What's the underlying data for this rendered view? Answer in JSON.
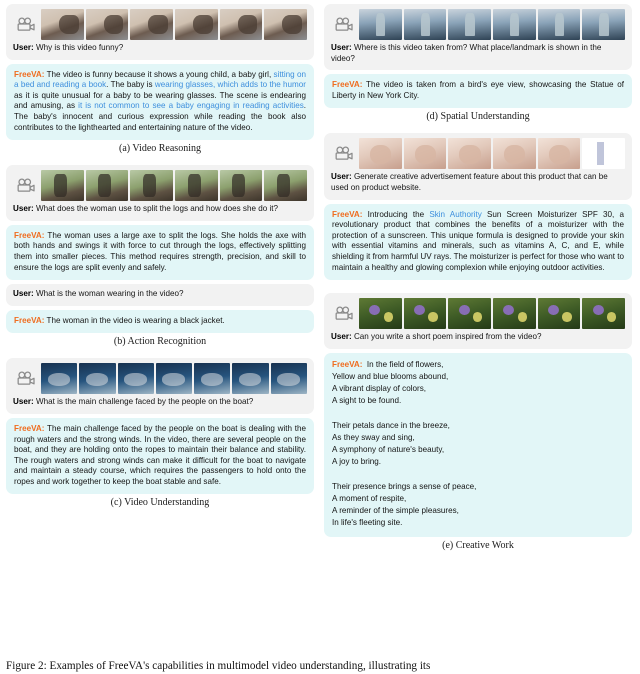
{
  "figure": {
    "caption": "Figure 2: Examples of FreeVA's capabilities in multimodel video understanding, illustrating its"
  },
  "labels": {
    "user": "User:",
    "assistant": "FreeVA:",
    "camera_icon": "movie-camera-icon"
  },
  "colors": {
    "user_bubble": "#f2f2f2",
    "assistant_bubble": "#e2f6f7",
    "assistant_name": "#ef6c1f",
    "highlight_text": "#3d8fdd",
    "body_text": "#151515"
  },
  "panels": [
    {
      "id": "a",
      "subcaption": "(a) Video Reasoning",
      "thumbnail_count": 6,
      "thumbnail_style": "t-baby",
      "turns": [
        {
          "role": "user",
          "segments": [
            {
              "text": "Why is this video funny?",
              "highlight": false
            }
          ]
        },
        {
          "role": "assistant",
          "segments": [
            {
              "text": " The video is funny because it shows a young child, a baby girl, ",
              "highlight": false
            },
            {
              "text": "sitting on a bed and reading a book",
              "highlight": true
            },
            {
              "text": ". The baby is ",
              "highlight": false
            },
            {
              "text": "wearing glasses, which adds to the humor",
              "highlight": true
            },
            {
              "text": " as it is quite unusual for a baby to be wearing glasses. The scene is endearing and amusing, as ",
              "highlight": false
            },
            {
              "text": "it is not common to see a baby engaging in reading activities",
              "highlight": true
            },
            {
              "text": ". The baby's innocent and curious expression while reading the book also contributes to the lighthearted and entertaining nature of the video.",
              "highlight": false
            }
          ]
        }
      ]
    },
    {
      "id": "b",
      "subcaption": "(b) Action Recognition",
      "thumbnail_count": 6,
      "thumbnail_style": "t-log",
      "turns": [
        {
          "role": "user",
          "segments": [
            {
              "text": "What does the woman use to split the logs and how does she do it?",
              "highlight": false
            }
          ]
        },
        {
          "role": "assistant",
          "segments": [
            {
              "text": " The woman uses a large axe to split the logs. She holds the axe with both hands and swings it with force to cut through the logs, effectively splitting them into smaller pieces. This method requires strength, precision, and skill to ensure the logs are split evenly and safely.",
              "highlight": false
            }
          ]
        },
        {
          "role": "user",
          "segments": [
            {
              "text": "What is the woman wearing in the video?",
              "highlight": false
            }
          ]
        },
        {
          "role": "assistant",
          "segments": [
            {
              "text": " The woman in the video is wearing a black jacket.",
              "highlight": false
            }
          ]
        }
      ]
    },
    {
      "id": "c",
      "subcaption": "(c) Video Understanding",
      "thumbnail_count": 7,
      "thumbnail_style": "t-boat",
      "turns": [
        {
          "role": "user",
          "segments": [
            {
              "text": "What is the main challenge faced by the people on the boat?",
              "highlight": false
            }
          ]
        },
        {
          "role": "assistant",
          "segments": [
            {
              "text": " The main challenge faced by the people on the boat is dealing with the rough waters and the strong winds. In the video, there are several people on the boat, and they are holding onto the ropes to maintain their balance and stability. The rough waters and strong winds can make it difficult for the boat to navigate and maintain a steady course, which requires the passengers to hold onto the ropes and work together to keep the boat stable and safe.",
              "highlight": false
            }
          ]
        }
      ]
    },
    {
      "id": "d",
      "subcaption": "(d) Spatial Understanding",
      "thumbnail_count": 6,
      "thumbnail_style": "t-lib",
      "turns": [
        {
          "role": "user",
          "segments": [
            {
              "text": "Where is this video taken from? What place/landmark is shown in the video?",
              "highlight": false
            }
          ]
        },
        {
          "role": "assistant",
          "segments": [
            {
              "text": " The video is taken from a bird's eye view, showcasing the Statue of Liberty in New York City.",
              "highlight": false
            }
          ]
        }
      ]
    },
    {
      "id": "ad",
      "subcaption": "",
      "thumbnail_count": 6,
      "thumbnail_style": "t-skin",
      "turns": [
        {
          "role": "user",
          "segments": [
            {
              "text": "Generate creative advertisement feature about this product that can be used on product website.",
              "highlight": false
            }
          ]
        },
        {
          "role": "assistant",
          "segments": [
            {
              "text": " Introducing the ",
              "highlight": false
            },
            {
              "text": "Skin Authority",
              "highlight": true
            },
            {
              "text": " Sun Screen Moisturizer SPF 30, a revolutionary product that combines the benefits of a moisturizer with the protection of a sunscreen. This unique formula is designed to provide your skin with essential vitamins and minerals, such as vitamins A, C, and E, while shielding it from harmful UV rays. The moisturizer is perfect for those who want to maintain a healthy and glowing complexion while enjoying outdoor activities.",
              "highlight": false
            }
          ]
        }
      ]
    },
    {
      "id": "e",
      "subcaption": "(e) Creative Work",
      "thumbnail_count": 6,
      "thumbnail_style": "t-flower",
      "turns": [
        {
          "role": "user",
          "segments": [
            {
              "text": "Can you write a short poem inspired from the video?",
              "highlight": false
            }
          ]
        },
        {
          "role": "assistant_poem",
          "poem": "  In the field of flowers,\nYellow and blue blooms abound,\nA vibrant display of colors,\nA sight to be found.\n\nTheir petals dance in the breeze,\nAs they sway and sing,\nA symphony of nature's beauty,\nA joy to bring.\n\nTheir presence brings a sense of peace,\nA moment of respite,\nA reminder of the simple pleasures,\nIn life's fleeting site."
        }
      ]
    }
  ]
}
